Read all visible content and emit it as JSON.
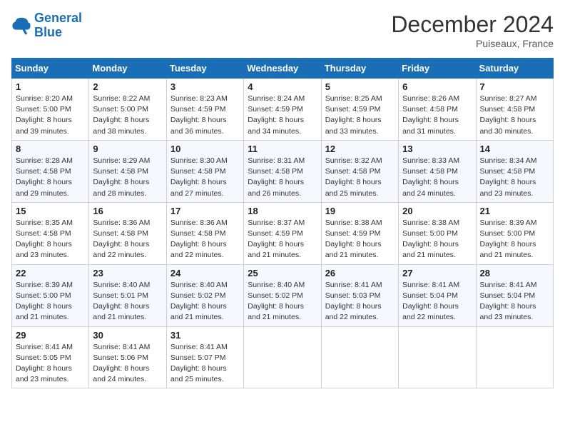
{
  "header": {
    "logo_line1": "General",
    "logo_line2": "Blue",
    "month": "December 2024",
    "location": "Puiseaux, France"
  },
  "days_of_week": [
    "Sunday",
    "Monday",
    "Tuesday",
    "Wednesday",
    "Thursday",
    "Friday",
    "Saturday"
  ],
  "weeks": [
    [
      {
        "day": "1",
        "lines": [
          "Sunrise: 8:20 AM",
          "Sunset: 5:00 PM",
          "Daylight: 8 hours",
          "and 39 minutes."
        ]
      },
      {
        "day": "2",
        "lines": [
          "Sunrise: 8:22 AM",
          "Sunset: 5:00 PM",
          "Daylight: 8 hours",
          "and 38 minutes."
        ]
      },
      {
        "day": "3",
        "lines": [
          "Sunrise: 8:23 AM",
          "Sunset: 4:59 PM",
          "Daylight: 8 hours",
          "and 36 minutes."
        ]
      },
      {
        "day": "4",
        "lines": [
          "Sunrise: 8:24 AM",
          "Sunset: 4:59 PM",
          "Daylight: 8 hours",
          "and 34 minutes."
        ]
      },
      {
        "day": "5",
        "lines": [
          "Sunrise: 8:25 AM",
          "Sunset: 4:59 PM",
          "Daylight: 8 hours",
          "and 33 minutes."
        ]
      },
      {
        "day": "6",
        "lines": [
          "Sunrise: 8:26 AM",
          "Sunset: 4:58 PM",
          "Daylight: 8 hours",
          "and 31 minutes."
        ]
      },
      {
        "day": "7",
        "lines": [
          "Sunrise: 8:27 AM",
          "Sunset: 4:58 PM",
          "Daylight: 8 hours",
          "and 30 minutes."
        ]
      }
    ],
    [
      {
        "day": "8",
        "lines": [
          "Sunrise: 8:28 AM",
          "Sunset: 4:58 PM",
          "Daylight: 8 hours",
          "and 29 minutes."
        ]
      },
      {
        "day": "9",
        "lines": [
          "Sunrise: 8:29 AM",
          "Sunset: 4:58 PM",
          "Daylight: 8 hours",
          "and 28 minutes."
        ]
      },
      {
        "day": "10",
        "lines": [
          "Sunrise: 8:30 AM",
          "Sunset: 4:58 PM",
          "Daylight: 8 hours",
          "and 27 minutes."
        ]
      },
      {
        "day": "11",
        "lines": [
          "Sunrise: 8:31 AM",
          "Sunset: 4:58 PM",
          "Daylight: 8 hours",
          "and 26 minutes."
        ]
      },
      {
        "day": "12",
        "lines": [
          "Sunrise: 8:32 AM",
          "Sunset: 4:58 PM",
          "Daylight: 8 hours",
          "and 25 minutes."
        ]
      },
      {
        "day": "13",
        "lines": [
          "Sunrise: 8:33 AM",
          "Sunset: 4:58 PM",
          "Daylight: 8 hours",
          "and 24 minutes."
        ]
      },
      {
        "day": "14",
        "lines": [
          "Sunrise: 8:34 AM",
          "Sunset: 4:58 PM",
          "Daylight: 8 hours",
          "and 23 minutes."
        ]
      }
    ],
    [
      {
        "day": "15",
        "lines": [
          "Sunrise: 8:35 AM",
          "Sunset: 4:58 PM",
          "Daylight: 8 hours",
          "and 23 minutes."
        ]
      },
      {
        "day": "16",
        "lines": [
          "Sunrise: 8:36 AM",
          "Sunset: 4:58 PM",
          "Daylight: 8 hours",
          "and 22 minutes."
        ]
      },
      {
        "day": "17",
        "lines": [
          "Sunrise: 8:36 AM",
          "Sunset: 4:58 PM",
          "Daylight: 8 hours",
          "and 22 minutes."
        ]
      },
      {
        "day": "18",
        "lines": [
          "Sunrise: 8:37 AM",
          "Sunset: 4:59 PM",
          "Daylight: 8 hours",
          "and 21 minutes."
        ]
      },
      {
        "day": "19",
        "lines": [
          "Sunrise: 8:38 AM",
          "Sunset: 4:59 PM",
          "Daylight: 8 hours",
          "and 21 minutes."
        ]
      },
      {
        "day": "20",
        "lines": [
          "Sunrise: 8:38 AM",
          "Sunset: 5:00 PM",
          "Daylight: 8 hours",
          "and 21 minutes."
        ]
      },
      {
        "day": "21",
        "lines": [
          "Sunrise: 8:39 AM",
          "Sunset: 5:00 PM",
          "Daylight: 8 hours",
          "and 21 minutes."
        ]
      }
    ],
    [
      {
        "day": "22",
        "lines": [
          "Sunrise: 8:39 AM",
          "Sunset: 5:00 PM",
          "Daylight: 8 hours",
          "and 21 minutes."
        ]
      },
      {
        "day": "23",
        "lines": [
          "Sunrise: 8:40 AM",
          "Sunset: 5:01 PM",
          "Daylight: 8 hours",
          "and 21 minutes."
        ]
      },
      {
        "day": "24",
        "lines": [
          "Sunrise: 8:40 AM",
          "Sunset: 5:02 PM",
          "Daylight: 8 hours",
          "and 21 minutes."
        ]
      },
      {
        "day": "25",
        "lines": [
          "Sunrise: 8:40 AM",
          "Sunset: 5:02 PM",
          "Daylight: 8 hours",
          "and 21 minutes."
        ]
      },
      {
        "day": "26",
        "lines": [
          "Sunrise: 8:41 AM",
          "Sunset: 5:03 PM",
          "Daylight: 8 hours",
          "and 22 minutes."
        ]
      },
      {
        "day": "27",
        "lines": [
          "Sunrise: 8:41 AM",
          "Sunset: 5:04 PM",
          "Daylight: 8 hours",
          "and 22 minutes."
        ]
      },
      {
        "day": "28",
        "lines": [
          "Sunrise: 8:41 AM",
          "Sunset: 5:04 PM",
          "Daylight: 8 hours",
          "and 23 minutes."
        ]
      }
    ],
    [
      {
        "day": "29",
        "lines": [
          "Sunrise: 8:41 AM",
          "Sunset: 5:05 PM",
          "Daylight: 8 hours",
          "and 23 minutes."
        ]
      },
      {
        "day": "30",
        "lines": [
          "Sunrise: 8:41 AM",
          "Sunset: 5:06 PM",
          "Daylight: 8 hours",
          "and 24 minutes."
        ]
      },
      {
        "day": "31",
        "lines": [
          "Sunrise: 8:41 AM",
          "Sunset: 5:07 PM",
          "Daylight: 8 hours",
          "and 25 minutes."
        ]
      },
      null,
      null,
      null,
      null
    ]
  ]
}
